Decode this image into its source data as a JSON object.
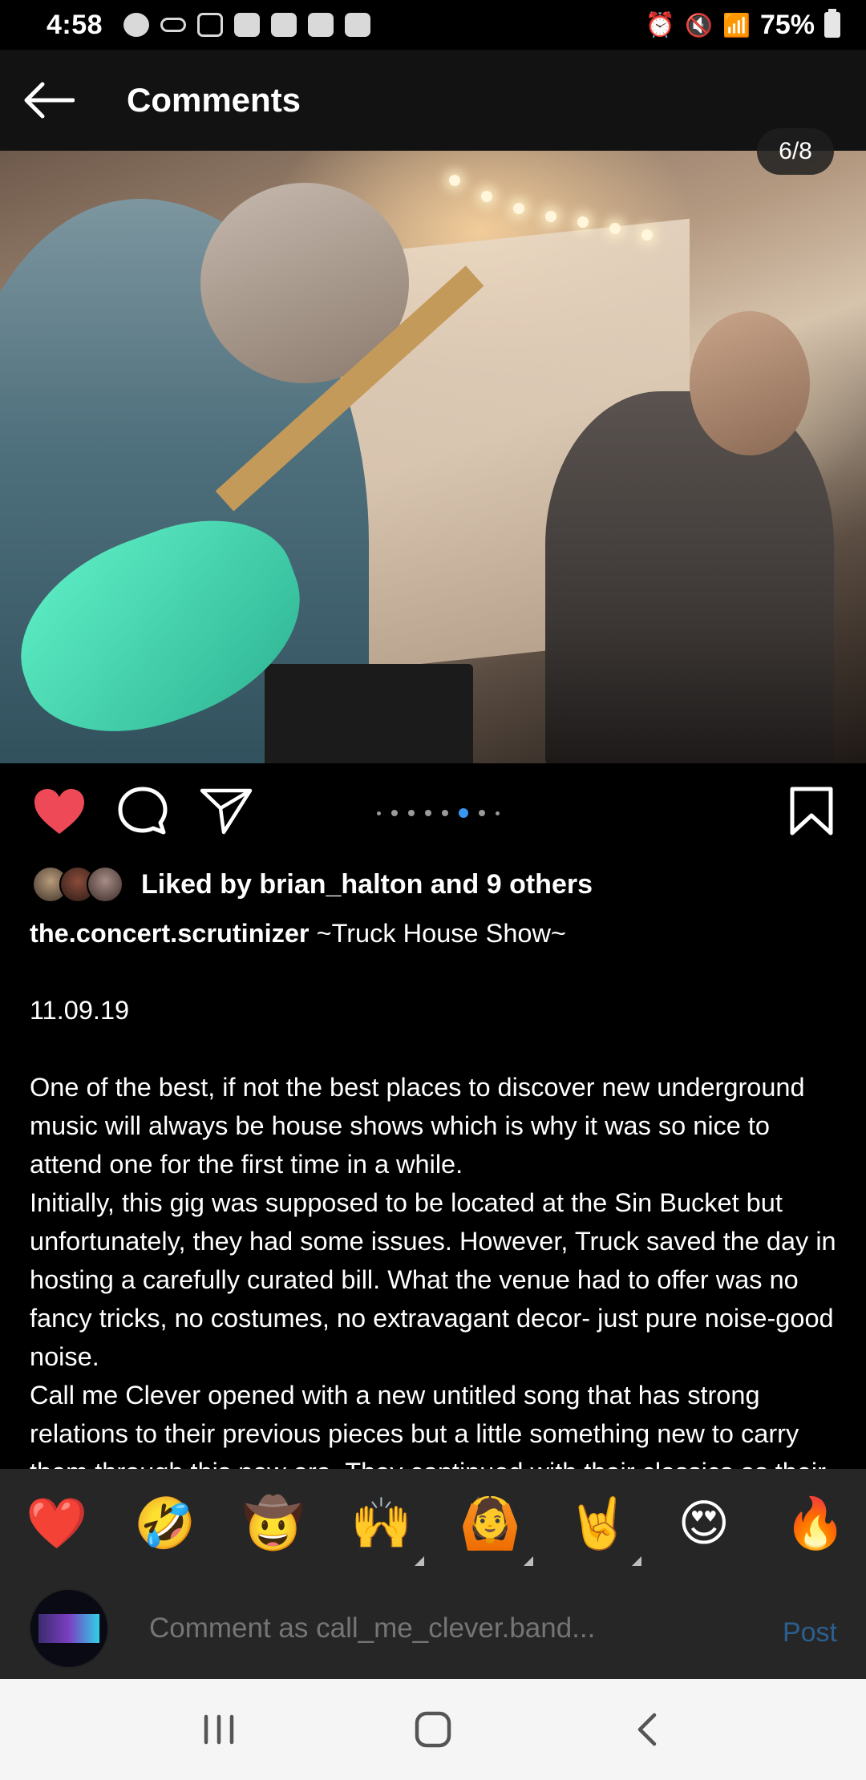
{
  "status_bar": {
    "time": "4:58",
    "battery": "75%"
  },
  "header": {
    "title": "Comments"
  },
  "post": {
    "page_indicator": "6/8",
    "carousel": {
      "count": 8,
      "active_index": 5
    },
    "liked": true,
    "likes_text": "Liked by brian_halton and 9 others",
    "username": "the.concert.scrutinizer",
    "caption_title": "~Truck House Show~",
    "date": "11.09.19",
    "paragraphs": [
      "One of the best, if not the best places to discover new underground music will always be house shows which is why it was so nice to attend one for the first time in a while.",
      "Initially, this gig was supposed to be located at the Sin Bucket but unfortunately, they had some issues. However, Truck saved the day in hosting a carefully curated bill.  What the venue had to offer was no fancy tricks, no costumes, no extravagant decor- just pure noise-good noise.",
      "Call me Clever opened with a new untitled song that has strong relations to their previous pieces but a little something new to carry them through this new era. They continued with their classics as their"
    ]
  },
  "emoji_bar": [
    {
      "glyph": "❤️",
      "name": "red-heart",
      "has_variants": false
    },
    {
      "glyph": "🤣",
      "name": "rolling-laughing",
      "has_variants": false
    },
    {
      "glyph": "🤠",
      "name": "cowboy",
      "has_variants": false
    },
    {
      "glyph": "🙌",
      "name": "raised-hands",
      "has_variants": true
    },
    {
      "glyph": "🙆",
      "name": "person-gesturing-ok",
      "has_variants": true
    },
    {
      "glyph": "🤘",
      "name": "sign-of-horns",
      "has_variants": true
    },
    {
      "glyph": "😍",
      "name": "heart-eyes",
      "has_variants": false
    },
    {
      "glyph": "🔥",
      "name": "fire",
      "has_variants": false
    }
  ],
  "comment_bar": {
    "placeholder": "Comment as call_me_clever.band...",
    "post_label": "Post"
  },
  "colors": {
    "like_red": "#ed4956",
    "link_blue": "#3897f0",
    "post_disabled": "#2b5f8f"
  }
}
